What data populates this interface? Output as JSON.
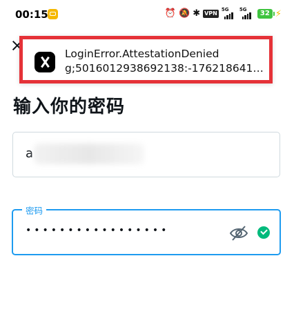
{
  "status_bar": {
    "time": "00:15",
    "network_1": "5G",
    "network_2": "5G",
    "vpn": "VPN",
    "battery": "32"
  },
  "toast": {
    "title": "LoginError.AttestationDenied",
    "body": "g;5016012938692138:-176218641…",
    "app_icon": "x-logo-icon",
    "border_color": "#e53238"
  },
  "page": {
    "title": "输入你的密码"
  },
  "username_field": {
    "value": "a"
  },
  "password_field": {
    "label": "密码",
    "value": "•••••••••••••••••",
    "accent": "#1d9bf0"
  }
}
